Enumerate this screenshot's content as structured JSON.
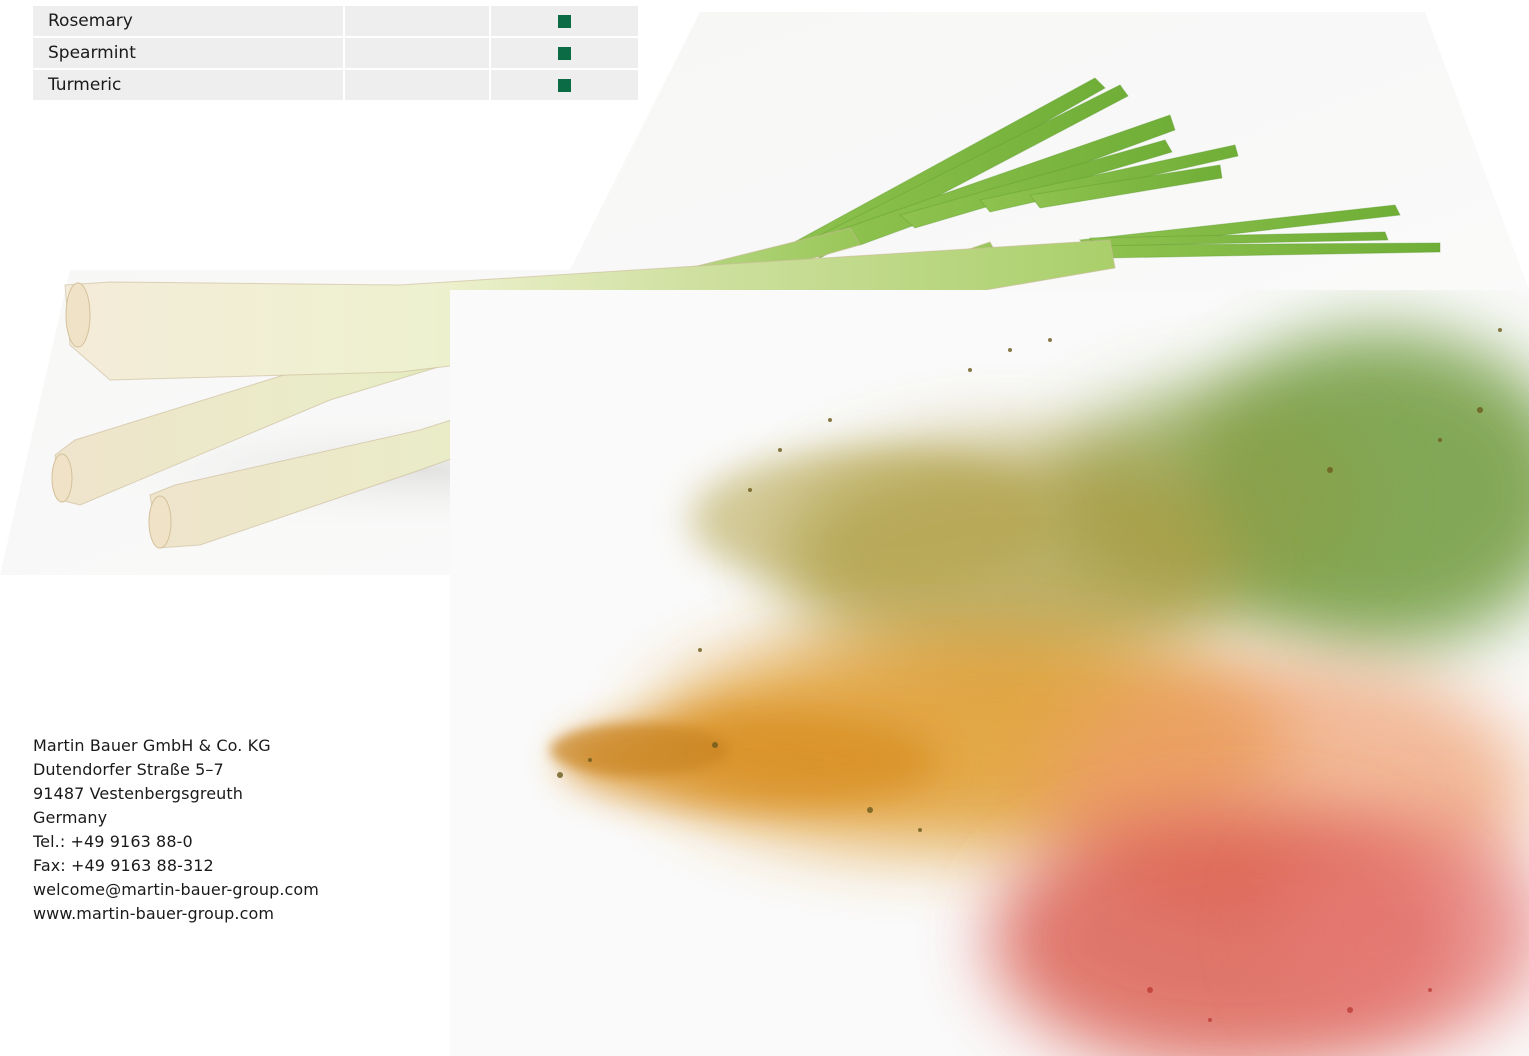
{
  "table": {
    "rows": [
      {
        "name": "Rosemary",
        "middle": "",
        "checked": true
      },
      {
        "name": "Spearmint",
        "middle": "",
        "checked": true
      },
      {
        "name": "Turmeric",
        "middle": "",
        "checked": true
      }
    ],
    "mark_color": "#0b6b45",
    "cell_color": "#eeeeee"
  },
  "images": {
    "top": "lemongrass",
    "bottom": "colored-powder-splash"
  },
  "address": {
    "company": "Martin Bauer GmbH & Co. KG",
    "street": "Dutendorfer Straße 5–7",
    "city": "91487 Vestenbergsgreuth",
    "country": "Germany",
    "phone": "Tel.: +49 9163 88-0",
    "fax": "Fax: +49 9163 88-312",
    "email": "welcome@martin-bauer-group.com",
    "website": "www.martin-bauer-group.com"
  }
}
